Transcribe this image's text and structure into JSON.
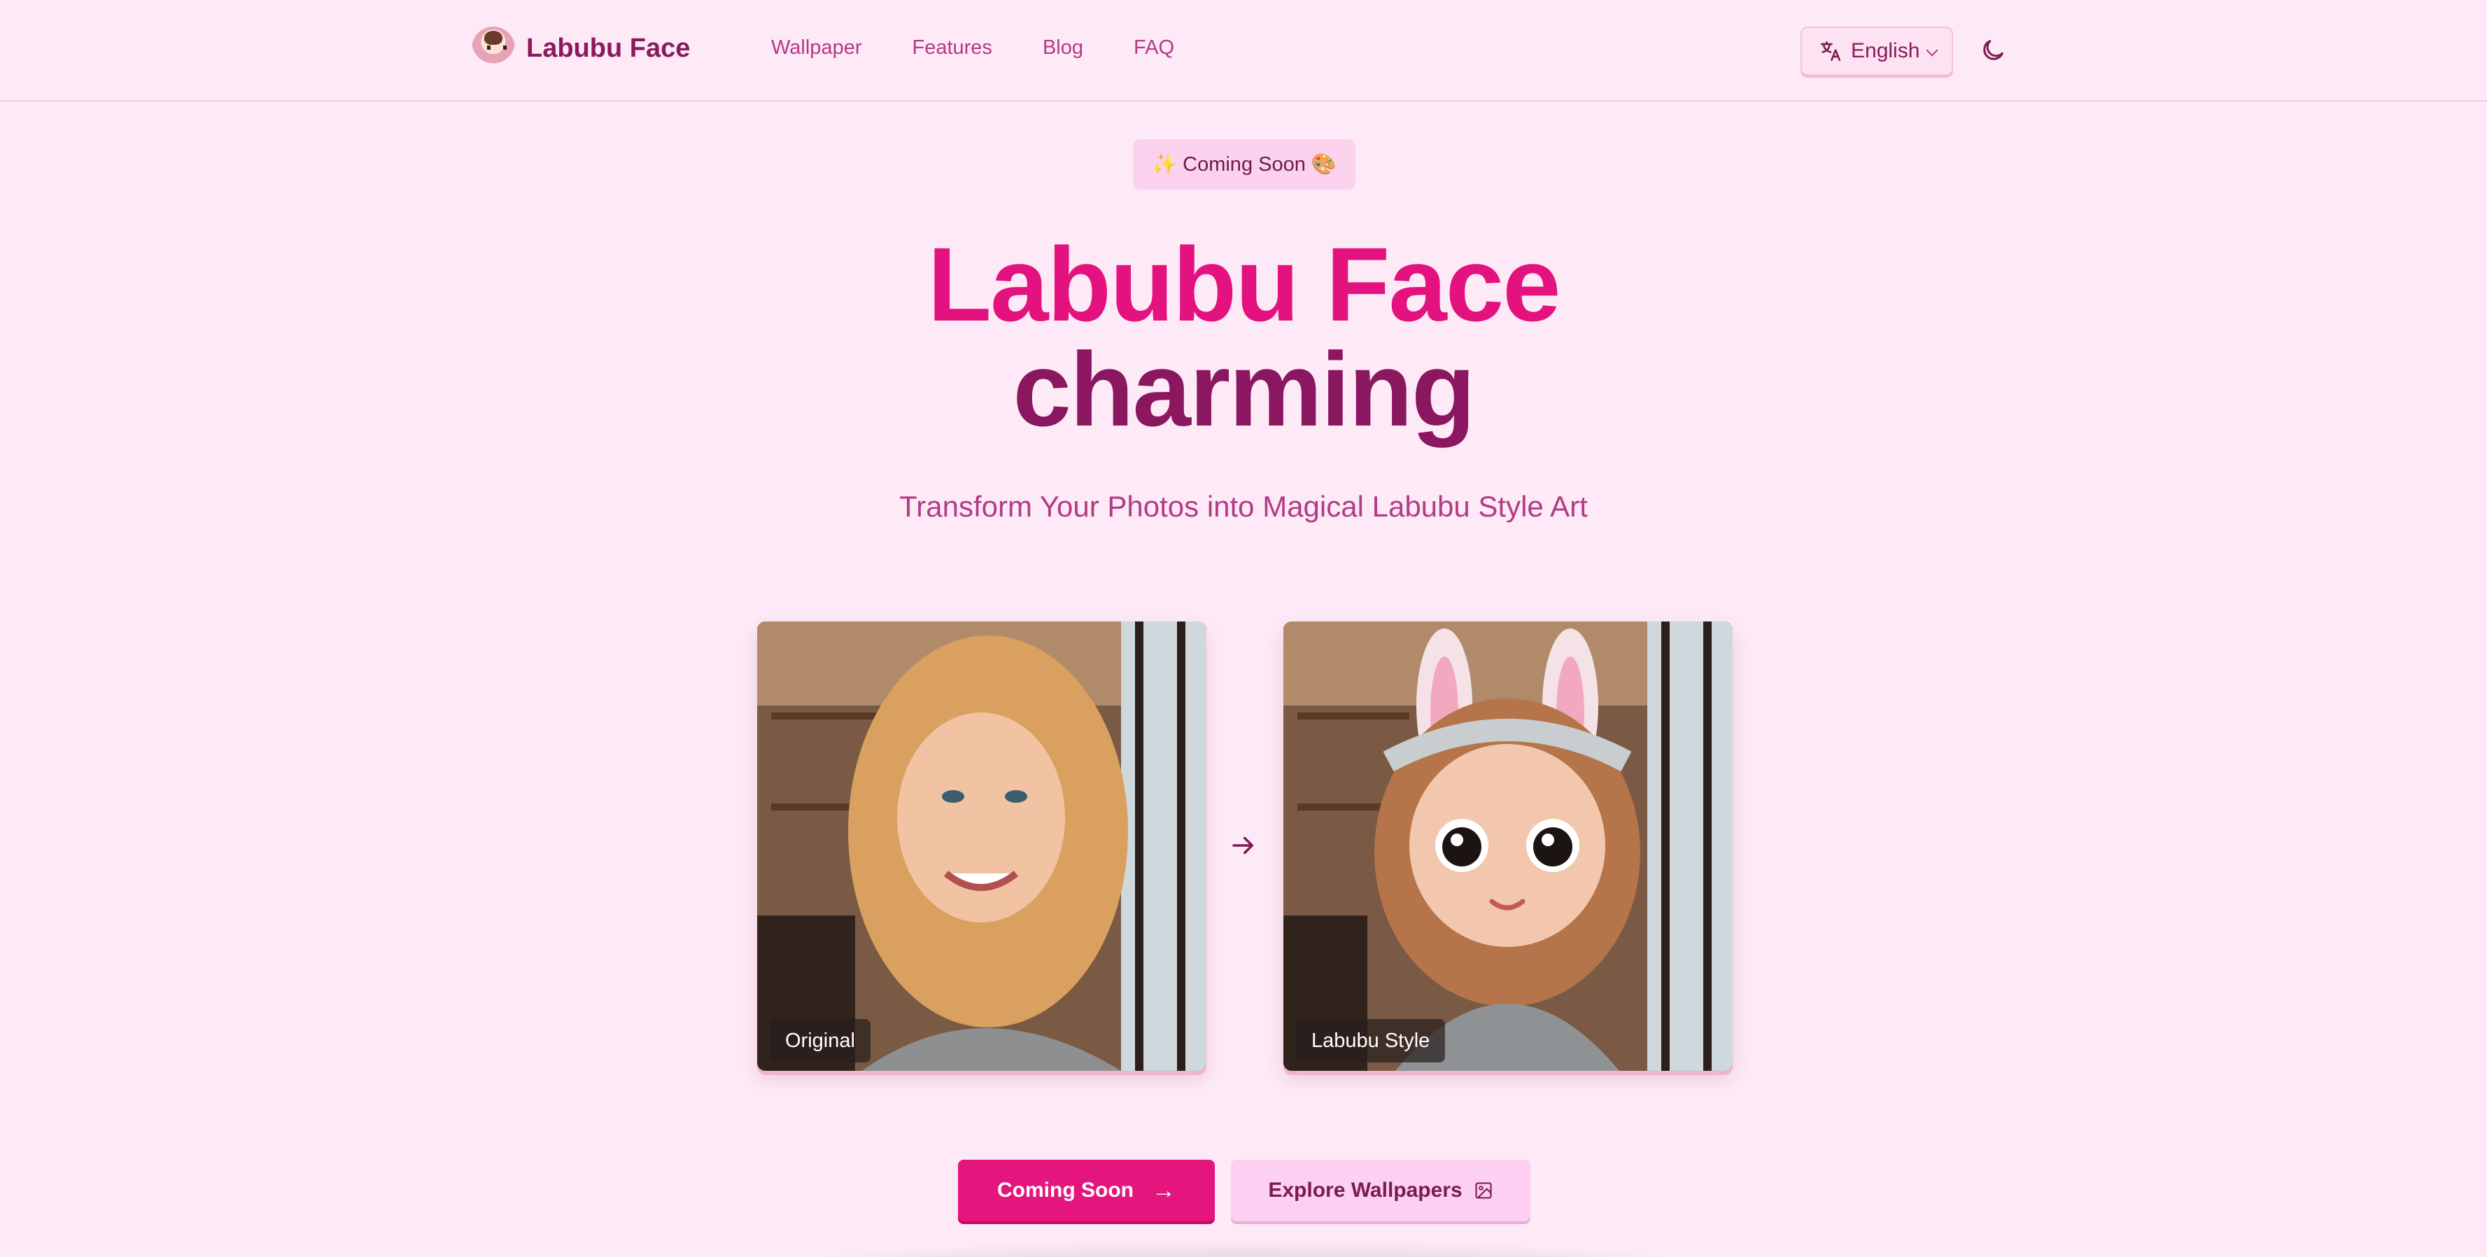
{
  "header": {
    "brand_name": "Labubu Face",
    "nav": [
      "Wallpaper",
      "Features",
      "Blog",
      "FAQ"
    ],
    "language": {
      "selected": "English",
      "icon": "translate-icon"
    },
    "theme_toggle_icon": "moon-icon"
  },
  "hero": {
    "badge": {
      "spark": "✨",
      "text": "Coming Soon",
      "emoji": "🎨"
    },
    "title_line1": "Labubu Face",
    "title_line2": "charming",
    "subtitle": "Transform Your Photos into Magical Labubu Style Art"
  },
  "comparison": {
    "original_label": "Original",
    "styled_label": "Labubu Style",
    "arrow_icon": "arrow-right-icon"
  },
  "actions": {
    "primary_label": "Coming Soon",
    "primary_arrow": "→",
    "secondary_label": "Explore Wallpapers",
    "secondary_icon": "image-icon"
  },
  "colors": {
    "background": "#fdeaf6",
    "accent": "#e3127e",
    "deep": "#8a1760"
  }
}
